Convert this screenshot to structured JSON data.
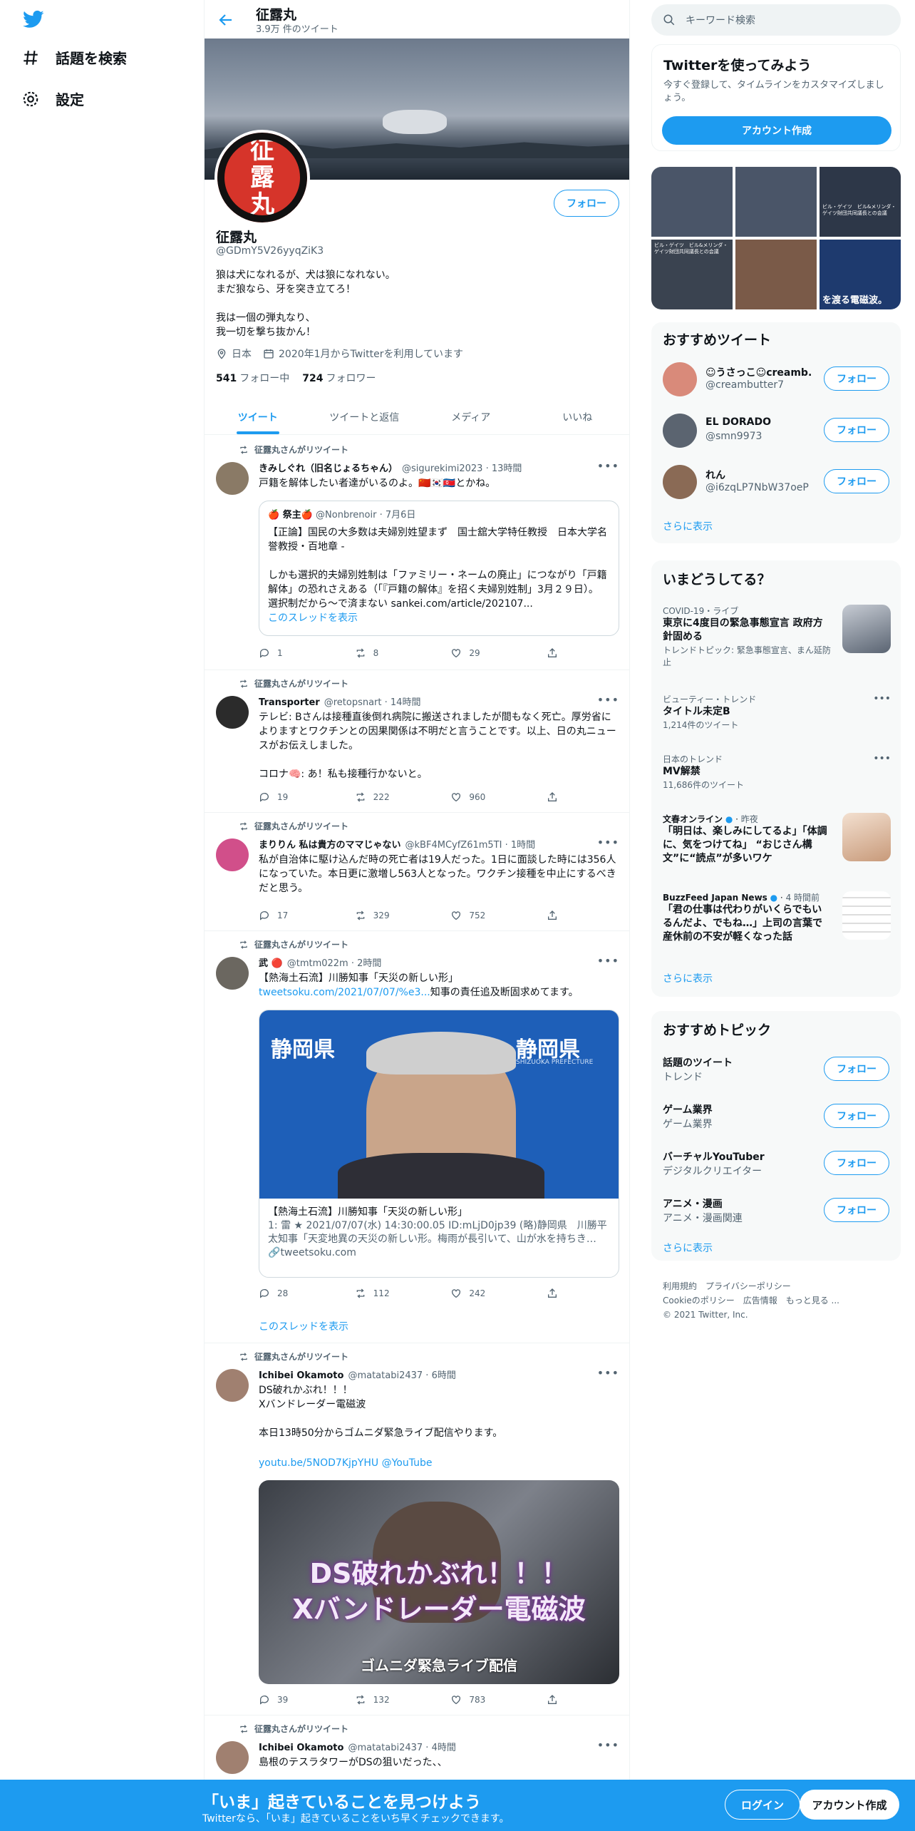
{
  "nav": {
    "items": [
      {
        "label": "話題を検索",
        "icon": "hashtag-icon"
      },
      {
        "label": "設定",
        "icon": "gear-icon"
      }
    ]
  },
  "header": {
    "title": "征露丸",
    "subtitle": "3.9万 件のツイート"
  },
  "profile": {
    "name": "征露丸",
    "handle": "@GDmY5V26yyqZiK3",
    "follow_label": "フォロー",
    "bio": "狼は犬になれるが、犬は狼になれない。\nまだ狼なら、牙を突き立てろ！\n\n我は一個の弾丸なり、\n我一切を撃ち抜かん！",
    "location": "日本",
    "joined": "2020年1月からTwitterを利用しています",
    "following_count": "541",
    "following_label": "フォロー中",
    "followers_count": "724",
    "followers_label": "フォロワー",
    "avatar_text": [
      "征",
      "露",
      "丸"
    ]
  },
  "tabs": [
    {
      "label": "ツイート",
      "active": true
    },
    {
      "label": "ツイートと返信",
      "active": false
    },
    {
      "label": "メディア",
      "active": false
    },
    {
      "label": "いいね",
      "active": false
    }
  ],
  "tweets": [
    {
      "retweet_label": "征露丸さんがリツイート",
      "name": "きみしぐれ（旧名じょるちゃん）",
      "handle": "@sigurekimi2023",
      "time": "13時間",
      "text": "戸籍を解体したい者達がいるのよ。🇨🇳🇰🇷🇰🇵とかね。",
      "quote": {
        "name": "🍎 祭主🍎",
        "handle": "@Nonbrenoir",
        "time": "7月6日",
        "text": "【正論】国民の大多数は夫婦別姓望まず　国士舘大学特任教授　日本大学名誉教授・百地章 -\n\nしかも選択的夫婦別姓制は「ファミリー・ネームの廃止」につながり「戸籍解体」の恐れさえある（「『戸籍の解体』を招く夫婦別姓制」3月２９日）。　選択制だから〜で済まない sankei.com/article/202107...",
        "thread_link": "このスレッドを表示"
      },
      "replies": "1",
      "retweets": "8",
      "likes": "29"
    },
    {
      "retweet_label": "征露丸さんがリツイート",
      "name": "Transporter",
      "handle": "@retopsnart",
      "time": "14時間",
      "text": "テレビ: Bさんは接種直後倒れ病院に搬送されましたが間もなく死亡。厚労省によりますとワクチンとの因果関係は不明だと言うことです。以上、日の丸ニュースがお伝えしました。\n\nコロナ🧠: あ！私も接種行かないと。",
      "replies": "19",
      "retweets": "222",
      "likes": "960"
    },
    {
      "retweet_label": "征露丸さんがリツイート",
      "name": "まりりん 私は貴方のママじゃない",
      "handle": "@kBF4MCyfZ61m5TI",
      "time": "1時間",
      "text": "私が自治体に駆け込んだ時の死亡者は19人だった。1日に面談した時には356人になっていた。本日更に激増し563人となった。ワクチン接種を中止にするべきだと思う。",
      "replies": "17",
      "retweets": "329",
      "likes": "752"
    },
    {
      "retweet_label": "征露丸さんがリツイート",
      "name": "武 🔴",
      "handle": "@tmtm022m",
      "time": "2時間",
      "text": "【熱海土石流】川勝知事「天災の新しい形」",
      "link": "tweetsoku.com/2021/07/07/%e3...",
      "text2": "知事の責任追及断固求めてます。",
      "card": {
        "sign_left": "静岡県",
        "sign_right": "静岡県",
        "sign_sub": "SHIZUOKA PREFECTURE",
        "title": "【熱海土石流】川勝知事「天災の新しい形」",
        "desc": "1: 雷 ★ 2021/07/07(水) 14:30:00.05 ID:mLjD0jp39 (略)静岡県　川勝平太知事「天変地異の天災の新しい形。梅雨が長引いて、山が水を持ちき…",
        "domain": "tweetsoku.com"
      },
      "thread_link": "このスレッドを表示",
      "replies": "28",
      "retweets": "112",
      "likes": "242"
    },
    {
      "retweet_label": "征露丸さんがリツイート",
      "name": "Ichibei Okamoto",
      "handle": "@matatabi2437",
      "time": "6時間",
      "text": "DS破れかぶれ！！！\nXバンドレーダー電磁波\n\n本日13時50分からゴムニダ緊急ライブ配信やります。",
      "links": [
        "youtu.be/5NOD7KjpYHU",
        "@YouTube"
      ],
      "media": {
        "line1": "DS破れかぶれ！！！",
        "line2": "Xバンドレーダー電磁波",
        "caption": "ゴムニダ緊急ライブ配信"
      },
      "replies": "39",
      "retweets": "132",
      "likes": "783"
    },
    {
      "retweet_label": "征露丸さんがリツイート",
      "name": "Ichibei Okamoto",
      "handle": "@matatabi2437",
      "time": "4時間",
      "text": "島根のテスラタワーがDSの狙いだった、、"
    }
  ],
  "right": {
    "search_placeholder": "キーワード検索",
    "signup_box": {
      "title": "Twitterを使ってみよう",
      "desc": "今すぐ登録して、タイムラインをカスタマイズしましょう。",
      "button": "アカウント作成"
    },
    "media_strip": {
      "caption_1": "ビル・ゲイツ　ビル&メリンダ・ゲイツ財団共同議長との会議",
      "caption_2": "ビル・ゲイツ　ビル&メリンダ・ゲイツ財団共同議長との会議",
      "caption_3": "を渡る電磁波。"
    },
    "recommended": {
      "title": "おすすめツイート",
      "items": [
        {
          "name": "☺うさっこ☺creamb...",
          "handle": "@creambutter7",
          "button": "フォロー",
          "color": "#d98a7a"
        },
        {
          "name": "EL DORADO",
          "handle": "@smn9973",
          "button": "フォロー",
          "color": "#5b6470"
        },
        {
          "name": "れん",
          "handle": "@i6zqLP7NbW37oeP",
          "button": "フォロー",
          "color": "#8a6a55"
        }
      ],
      "more": "さらに表示"
    },
    "trends": {
      "title": "いまどうしてる？",
      "items": [
        {
          "category": "COVID-19・ライブ",
          "title": "東京に4度目の緊急事態宣言 政府方針固める",
          "sub": "トレンドトピック: 緊急事態宣言、まん延防止"
        },
        {
          "category": "ビューティー・トレンド",
          "title": "タイトル未定B",
          "sub": "1,214件のツイート"
        },
        {
          "category": "日本のトレンド",
          "title": "MV解禁",
          "sub": "11,686件のツイート"
        },
        {
          "category": "文春オンライン",
          "time": "昨夜",
          "title": "「明日は、楽しみにしてるよ」「体調に、気をつけてね」 “おじさん構文”に“読点”が多いワケ"
        },
        {
          "category": "BuzzFeed Japan News",
          "time": "4 時間前",
          "title": "「君の仕事は代わりがいくらでもいるんだよ、でもね…」上司の言葉で産休前の不安が軽くなった話"
        }
      ],
      "more": "さらに表示"
    },
    "topics": {
      "title": "おすすめトピック",
      "items": [
        {
          "title": "話題のツイート",
          "sub": "トレンド",
          "button": "フォロー"
        },
        {
          "title": "ゲーム業界",
          "sub": "ゲーム業界",
          "button": "フォロー"
        },
        {
          "title": "バーチャルYouTuber",
          "sub": "デジタルクリエイター",
          "button": "フォロー"
        },
        {
          "title": "アニメ・漫画",
          "sub": "アニメ・漫画関連",
          "button": "フォロー"
        }
      ],
      "more": "さらに表示"
    },
    "footer": {
      "line1": "利用規約　プライバシーポリシー",
      "line2": "Cookieのポリシー　広告情報　もっと見る ...",
      "line3": "© 2021 Twitter, Inc."
    }
  },
  "bottom_bar": {
    "title": "「いま」起きていることを見つけよう",
    "subtitle": "Twitterなら、「いま」起きていることをいち早くチェックできます。",
    "login": "ログイン",
    "signup": "アカウント作成"
  },
  "colors": {
    "accent": "#1d9bf0",
    "text": "#0f1419",
    "secondary": "#536471"
  }
}
